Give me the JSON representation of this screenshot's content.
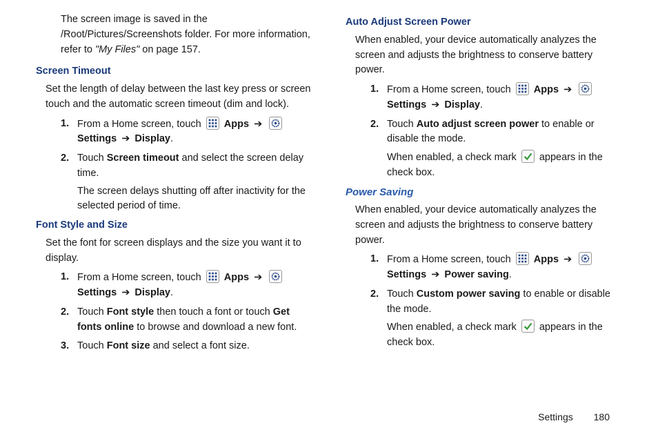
{
  "col1": {
    "intro": {
      "t1": "The screen image is saved in the /Root/Pictures/Screenshots folder. For more information, refer to ",
      "t2": "\"My Files\"",
      "t3": " on page 157."
    },
    "screen_timeout": {
      "heading": "Screen Timeout",
      "desc": "Set the length of delay between the last key press or screen touch and the automatic screen timeout (dim and lock).",
      "s1": {
        "a": "From a Home screen, touch ",
        "apps": "Apps",
        "arrow1": "➔",
        "settings": "Settings",
        "arrow2": "➔",
        "display": "Display",
        "dot": "."
      },
      "s2": {
        "a": "Touch ",
        "b": "Screen timeout",
        "c": " and select the screen delay time.",
        "cont": "The screen delays shutting off after inactivity for the selected period of time."
      }
    },
    "font": {
      "heading": "Font Style and Size",
      "desc": "Set the font for screen displays and the size you want it to display.",
      "s1": {
        "a": "From a Home screen, touch ",
        "apps": "Apps",
        "arrow1": "➔",
        "settings": "Settings",
        "arrow2": "➔",
        "display": "Display",
        "dot": "."
      },
      "s2": {
        "a": "Touch ",
        "b": "Font style",
        "c": " then touch a font or touch ",
        "d": "Get fonts online",
        "e": " to browse and download a new font."
      },
      "s3": {
        "a": "Touch ",
        "b": "Font size",
        "c": " and select a font size."
      }
    }
  },
  "col2": {
    "auto": {
      "heading": "Auto Adjust Screen Power",
      "desc": "When enabled, your device automatically analyzes the screen and adjusts the brightness to conserve battery power.",
      "s1": {
        "a": "From a Home screen, touch ",
        "apps": "Apps",
        "arrow1": "➔",
        "settings": "Settings",
        "arrow2": "➔",
        "display": "Display",
        "dot": "."
      },
      "s2": {
        "a": "Touch ",
        "b": "Auto adjust screen power",
        "c": " to enable or disable the mode.",
        "cont1": "When enabled, a check mark ",
        "cont2": " appears in the check box."
      }
    },
    "power": {
      "heading": "Power Saving",
      "desc": "When enabled, your device automatically analyzes the screen and adjusts the brightness to conserve battery power.",
      "s1": {
        "a": "From a Home screen, touch ",
        "apps": "Apps",
        "arrow1": "➔",
        "settings": "Settings",
        "arrow2": "➔",
        "ps": "Power saving",
        "dot": "."
      },
      "s2": {
        "a": "Touch ",
        "b": "Custom power saving",
        "c": " to enable or disable the mode.",
        "cont1": "When enabled, a check mark ",
        "cont2": " appears in the check box."
      }
    }
  },
  "footer": {
    "section": "Settings",
    "page": "180"
  }
}
